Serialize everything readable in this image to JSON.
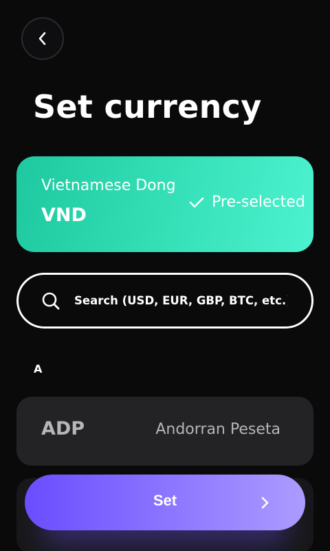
{
  "header": {
    "back_icon": "chevron-left-icon",
    "title": "Set currency"
  },
  "selected": {
    "name": "Vietnamese Dong",
    "code": "VND",
    "status_icon": "checkmark-icon",
    "status_label": "Pre-selected",
    "gradient_colors": [
      "#1ec9a0",
      "#4cf2cf"
    ]
  },
  "search": {
    "icon": "search-icon",
    "placeholder": "Search (USD, EUR, GBP, BTC, etc.)",
    "value": ""
  },
  "list": {
    "sections": [
      {
        "letter": "A",
        "items": [
          {
            "code": "ADP",
            "name": "Andorran Peseta"
          }
        ]
      }
    ]
  },
  "footer": {
    "set_label": "Set",
    "set_icon": "chevron-right-icon",
    "button_gradient": [
      "#6a4dff",
      "#ab9cff"
    ]
  },
  "colors": {
    "background": "#0a0a0b",
    "row_background": "#232325",
    "muted_text": "#b6b6ba"
  }
}
